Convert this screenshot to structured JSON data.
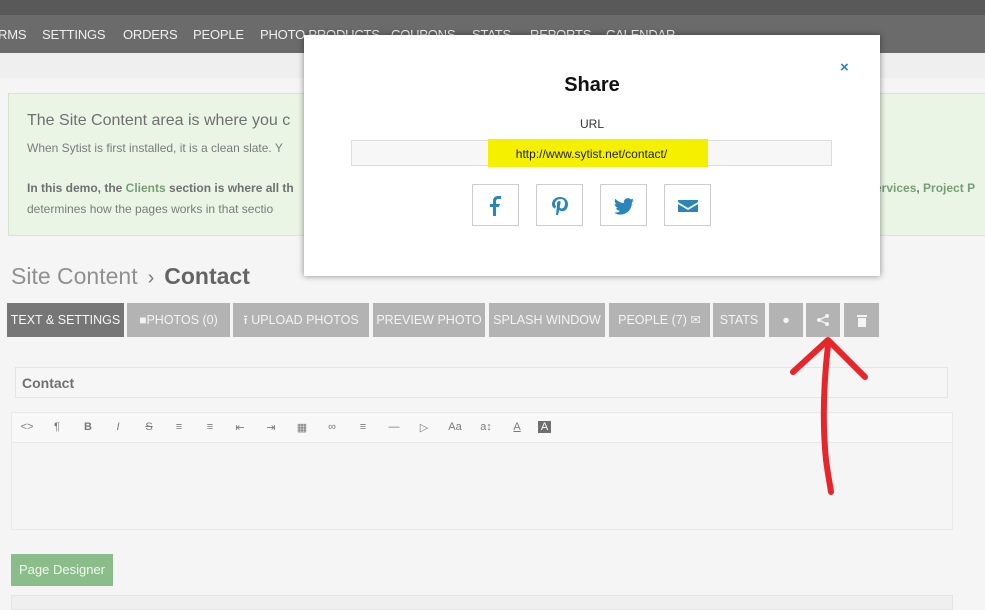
{
  "nav": {
    "items": [
      "RMS",
      "SETTINGS",
      "ORDERS",
      "PEOPLE",
      "PHOTO PRODUCTS",
      "COUPONS",
      "STATS",
      "REPORTS",
      "CALENDAR"
    ]
  },
  "info": {
    "line1": "The Site Content area is where you c",
    "line2": "When Sytist is first installed, it is a clean slate. Y",
    "line3_prefix": "In this demo, the ",
    "line3_link": "Clients",
    "line3_suffix": " section is where all th",
    "line3_right_link1": "ervices",
    "line3_right_sep": ", ",
    "line3_right_link2": "Project P",
    "line4": "determines how the pages works in that sectio"
  },
  "breadcrumb": {
    "parent": "Site Content",
    "separator": "›",
    "current": "Contact"
  },
  "toolbar": {
    "text_settings": "TEXT & SETTINGS",
    "photos": "PHOTOS (0)",
    "upload_photos": "UPLOAD PHOTOS",
    "preview_photo": "PREVIEW PHOTO",
    "splash_window": "SPLASH WINDOW",
    "people": "PEOPLE (7)",
    "stats": "STATS"
  },
  "page_title_value": "Contact",
  "page_designer_label": "Page Designer",
  "modal": {
    "title": "Share",
    "close": "×",
    "url_label": "URL",
    "url_value": "http://www.sytist.net/contact/"
  },
  "colors": {
    "nav_bg": "#1d1d1d",
    "info_bg": "#dff0d8",
    "highlight": "#f4f000",
    "share_icon": "#2a86b8",
    "annotation_arrow": "#e8262a"
  }
}
